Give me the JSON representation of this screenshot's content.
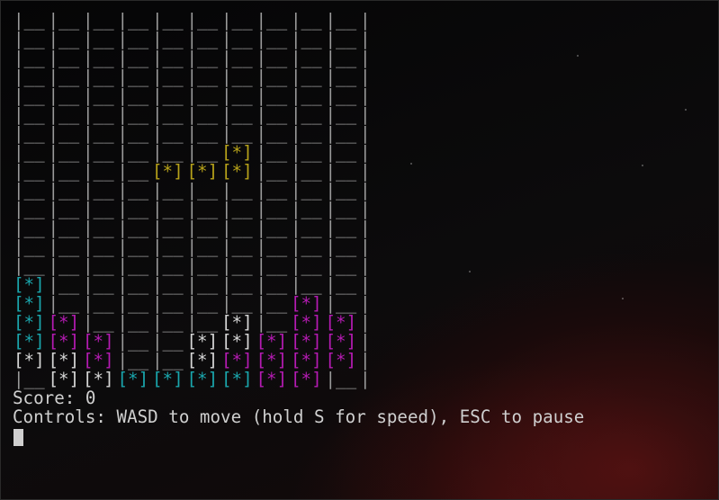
{
  "game": {
    "rows": 20,
    "cols": 10,
    "empty_cell": "__",
    "filled_cell": "[*]",
    "colors": {
      "Y": "#b7a21a",
      "C": "#1aa6ad",
      "M": "#b51bb3",
      "W": "#d6d6d6"
    },
    "grid": [
      "..........",
      "..........",
      "..........",
      "..........",
      "..........",
      "..........",
      "..........",
      "......Y...",
      "....YYY...",
      "..........",
      "..........",
      "..........",
      "..........",
      "..........",
      "C.........",
      "C.......M.",
      "CM....W.MM",
      "CMM..WWMMM",
      "WWM..WMMMM",
      ".WWCCCCMM."
    ]
  },
  "status": {
    "score_line": "Score: 0",
    "controls_line": "Controls: WASD to move (hold S for speed), ESC to pause"
  }
}
